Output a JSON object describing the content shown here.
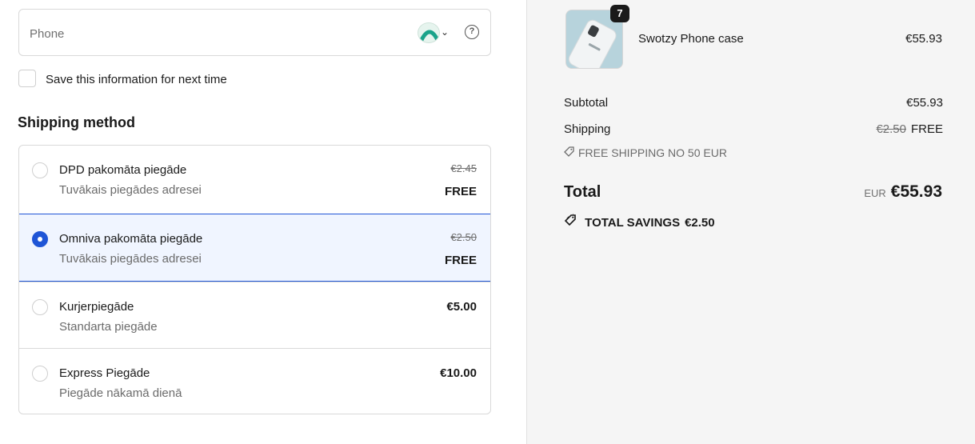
{
  "contact": {
    "phone_placeholder": "Phone",
    "help_symbol": "?",
    "save_label": "Save this information for next time"
  },
  "shipping": {
    "title": "Shipping method",
    "methods": [
      {
        "name": "DPD pakomāta piegāde",
        "desc": "Tuvākais piegādes adresei",
        "old_price": "€2.45",
        "price": "FREE",
        "selected": false
      },
      {
        "name": "Omniva pakomāta piegāde",
        "desc": "Tuvākais piegādes adresei",
        "old_price": "€2.50",
        "price": "FREE",
        "selected": true
      },
      {
        "name": "Kurjerpiegāde",
        "desc": "Standarta piegāde",
        "price": "€5.00",
        "selected": false
      },
      {
        "name": "Express Piegāde",
        "desc": "Piegāde nākamā dienā",
        "price": "€10.00",
        "selected": false
      }
    ]
  },
  "summary": {
    "item": {
      "quantity": "7",
      "name": "Swotzy Phone case",
      "price": "€55.93"
    },
    "subtotal_label": "Subtotal",
    "subtotal": "€55.93",
    "shipping_label": "Shipping",
    "shipping_old": "€2.50",
    "shipping_value": "FREE",
    "discount_code": "FREE SHIPPING NO 50 EUR",
    "total_label": "Total",
    "currency": "EUR",
    "total": "€55.93",
    "savings_label": "TOTAL SAVINGS",
    "savings": "€2.50"
  },
  "colors": {
    "accent": "#1f55d6",
    "selected_bg": "#f0f5ff",
    "summary_bg": "#f5f5f5"
  },
  "icons": [
    "country-flag-icon",
    "chevron-down-icon",
    "help-icon",
    "tag-icon"
  ]
}
